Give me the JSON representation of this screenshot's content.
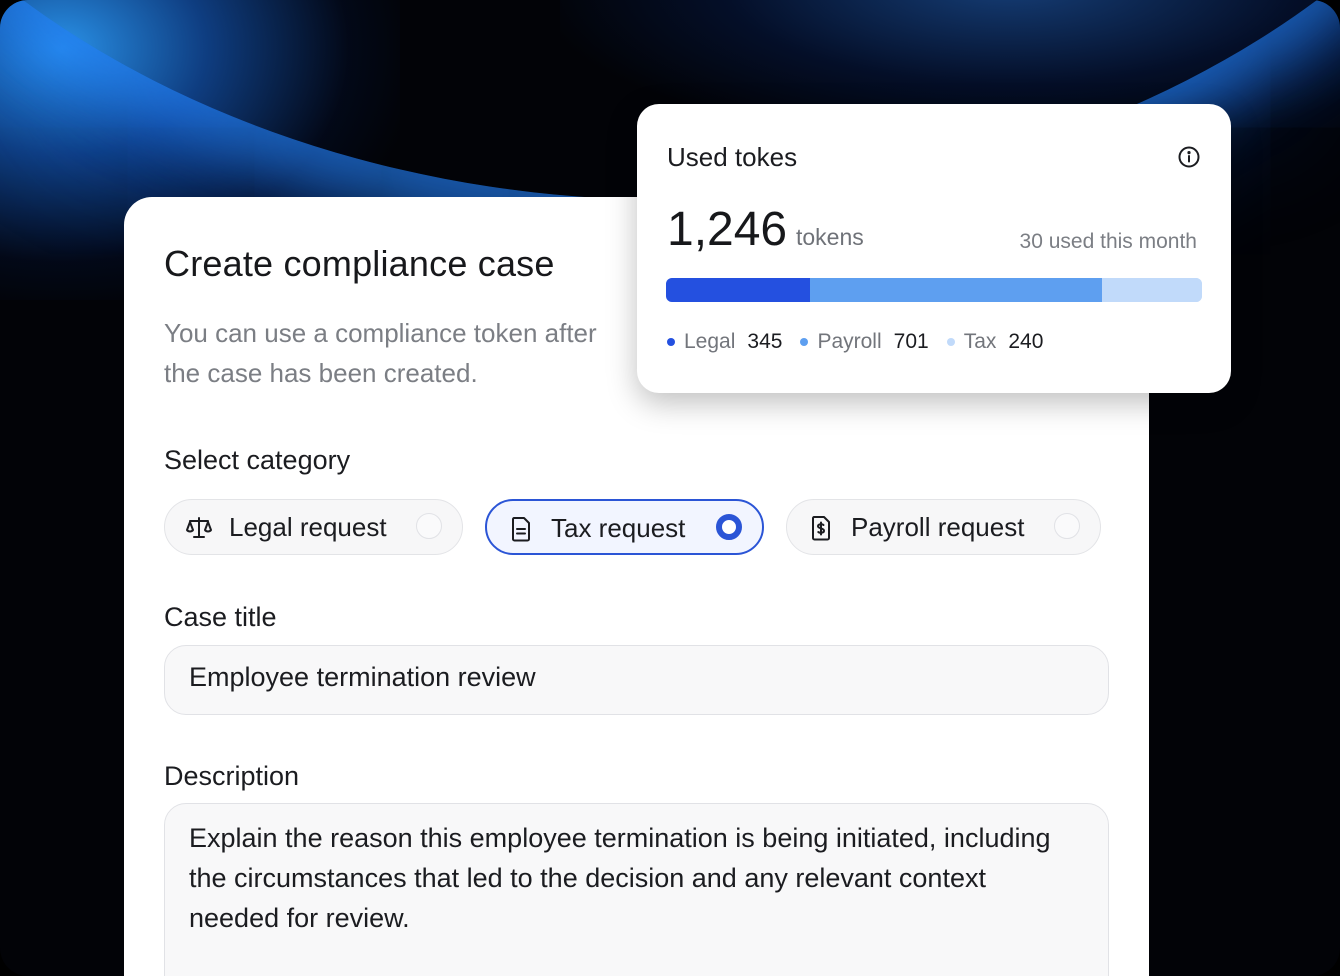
{
  "colors": {
    "accent": "#2b55d6",
    "legal": "#2450e0",
    "payroll": "#5e9ff0",
    "tax": "#c1dafa"
  },
  "form": {
    "title": "Create compliance case",
    "subtitle_line1": "You can use a compliance token after",
    "subtitle_line2": "the case has been created.",
    "category_label": "Select category",
    "categories": [
      {
        "label": "Legal request",
        "icon": "scale-icon",
        "selected": false
      },
      {
        "label": "Tax request",
        "icon": "document-icon",
        "selected": true
      },
      {
        "label": "Payroll request",
        "icon": "dollar-document-icon",
        "selected": false
      }
    ],
    "case_title_label": "Case title",
    "case_title_value": "Employee termination review",
    "description_label": "Description",
    "description_value": "Explain the reason this employee termination is being initiated, including the circumstances that led to the decision and any relevant context needed for review."
  },
  "tokens": {
    "title": "Used tokes",
    "total": "1,246",
    "unit": "tokens",
    "monthly": "30 used this month",
    "breakdown": [
      {
        "name": "Legal",
        "value": 345
      },
      {
        "name": "Payroll",
        "value": 701
      },
      {
        "name": "Tax",
        "value": 240
      }
    ]
  }
}
